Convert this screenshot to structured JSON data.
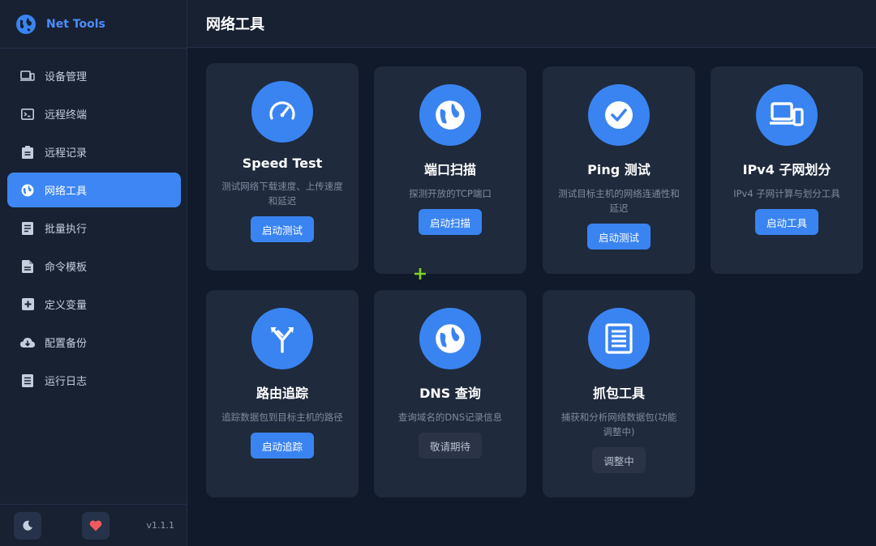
{
  "app": {
    "name": "Net Tools",
    "version": "v1.1.1"
  },
  "header": {
    "title": "网络工具"
  },
  "sidebar": {
    "items": [
      {
        "label": "设备管理",
        "icon": "devices-icon",
        "active": false
      },
      {
        "label": "远程终端",
        "icon": "terminal-icon",
        "active": false
      },
      {
        "label": "远程记录",
        "icon": "clipboard-icon",
        "active": false
      },
      {
        "label": "网络工具",
        "icon": "globe-icon",
        "active": true
      },
      {
        "label": "批量执行",
        "icon": "list-icon",
        "active": false
      },
      {
        "label": "命令模板",
        "icon": "document-icon",
        "active": false
      },
      {
        "label": "定义变量",
        "icon": "plus-box-icon",
        "active": false
      },
      {
        "label": "配置备份",
        "icon": "cloud-download-icon",
        "active": false
      },
      {
        "label": "运行日志",
        "icon": "log-icon",
        "active": false
      }
    ],
    "footer": {
      "theme_icon": "moon-icon",
      "favorite_icon": "heart-icon"
    }
  },
  "tools": [
    {
      "title": "Speed Test",
      "desc": "测试网络下载速度、上传速度和延迟",
      "button": "启动测试",
      "icon": "speedometer-icon",
      "enabled": true
    },
    {
      "title": "端口扫描",
      "desc": "探测开放的TCP端口",
      "button": "启动扫描",
      "icon": "globe-icon",
      "enabled": true
    },
    {
      "title": "Ping 测试",
      "desc": "测试目标主机的网络连通性和延迟",
      "button": "启动测试",
      "icon": "check-icon",
      "enabled": true
    },
    {
      "title": "IPv4 子网划分",
      "desc": "IPv4 子网计算与划分工具",
      "button": "启动工具",
      "icon": "devices-icon",
      "enabled": true
    },
    {
      "title": "路由追踪",
      "desc": "追踪数据包到目标主机的路径",
      "button": "启动追踪",
      "icon": "route-fork-icon",
      "enabled": true
    },
    {
      "title": "DNS 查询",
      "desc": "查询域名的DNS记录信息",
      "button": "敬请期待",
      "icon": "globe-icon",
      "enabled": false
    },
    {
      "title": "抓包工具",
      "desc": "捕获和分析网络数据包(功能调整中)",
      "button": "调整中",
      "icon": "packet-list-icon",
      "enabled": false
    }
  ],
  "colors": {
    "accent": "#3a84f1",
    "background": "#111a2b",
    "card": "#1f2a3c",
    "sidebar": "#172131"
  }
}
